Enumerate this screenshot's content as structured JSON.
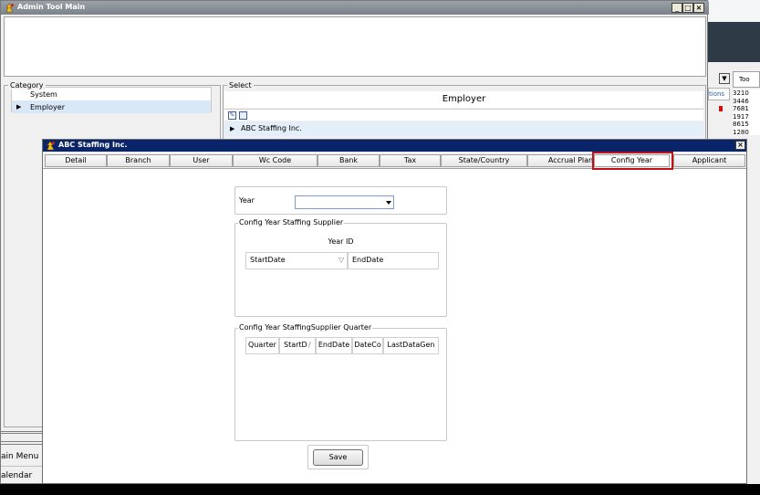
{
  "main_window": {
    "title": "Admin Tool Main",
    "controls": {
      "minimize": "_",
      "restore": "□",
      "close": "×"
    }
  },
  "category": {
    "label": "Category",
    "items": [
      {
        "label": "System"
      },
      {
        "label": "Employer"
      }
    ],
    "selected_marker": "▶"
  },
  "select": {
    "label": "Select",
    "header": "Employer",
    "row": "ABC Staffing Inc.",
    "row_marker": "▶"
  },
  "right_panel": {
    "column_fragment": "tions",
    "tool_fragment": "Too",
    "numbers": [
      "3210",
      "3446",
      "7681",
      "1917",
      "8615",
      "1280"
    ]
  },
  "sidebar_bottom": {
    "items": [
      "ain Menu",
      "alendar"
    ]
  },
  "dialog": {
    "title": "ABC Staffing Inc.",
    "close": "×",
    "tabs": [
      "Detail",
      "Branch",
      "User",
      "Wc Code",
      "Bank",
      "Tax",
      "State/Country",
      "Accrual Plan",
      "Config Year",
      "Applicant"
    ],
    "active_tab": "Config Year"
  },
  "config_year": {
    "year_label": "Year",
    "year_value": "",
    "supplier_group": {
      "label": "Config Year Staffing Supplier",
      "year_id_label": "Year ID",
      "columns": [
        "StartDate",
        "EndDate"
      ],
      "sort_glyph": "▽"
    },
    "quarter_group": {
      "label": "Config Year StaffingSupplier Quarter",
      "columns": [
        "Quarter",
        "StartD",
        "EndDate",
        "DateCo",
        "LastDataGen"
      ],
      "sort_glyph": "/"
    },
    "save_label": "Save"
  }
}
